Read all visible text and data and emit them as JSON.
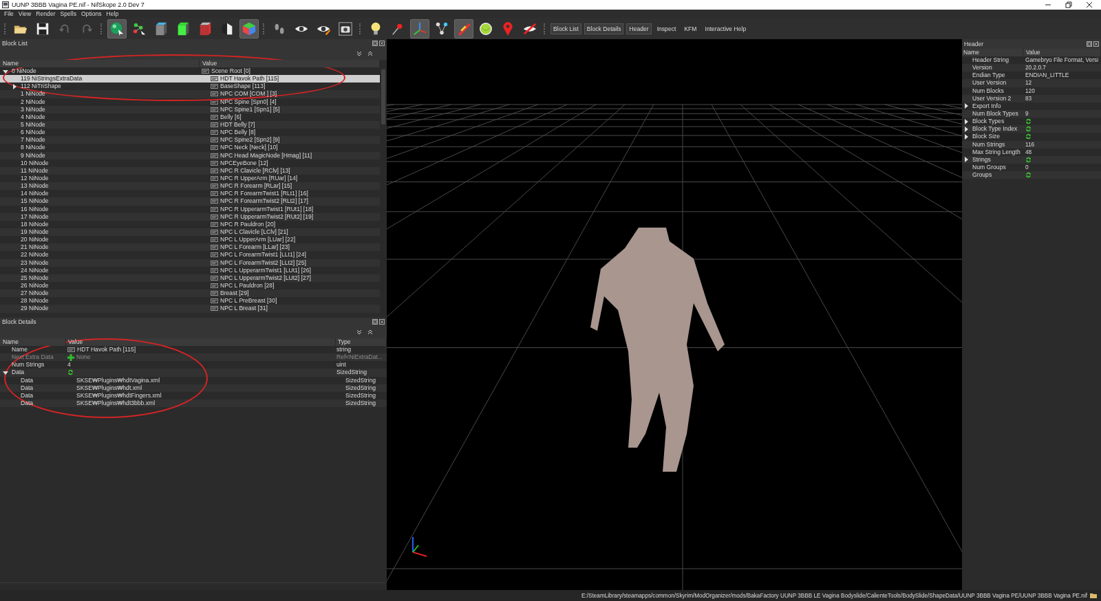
{
  "window": {
    "title": "UUNP 3BBB Vagina PE.nif - NifSkope 2.0 Dev 7"
  },
  "menu": [
    "File",
    "View",
    "Render",
    "Spells",
    "Options",
    "Help"
  ],
  "toolbar": {
    "tools": [
      {
        "pressed": false
      },
      {
        "pressed": false
      },
      {
        "pressed": false
      },
      {
        "pressed": false
      },
      {
        "pressed": true
      },
      {
        "pressed": false
      },
      {
        "pressed": false
      },
      {
        "pressed": false
      },
      {
        "pressed": false
      },
      {
        "pressed": false
      },
      {
        "pressed": true
      },
      {
        "pressed": false
      },
      {
        "pressed": false
      },
      {
        "pressed": false
      },
      {
        "pressed": false
      },
      {
        "pressed": false
      },
      {
        "pressed": false
      },
      {
        "pressed": true
      },
      {
        "pressed": false
      },
      {
        "pressed": true
      },
      {
        "pressed": false
      },
      {
        "pressed": false
      },
      {
        "pressed": false
      }
    ],
    "toggles": [
      {
        "label": "Block List",
        "checked": true
      },
      {
        "label": "Block Details",
        "checked": true
      },
      {
        "label": "Header",
        "checked": true
      },
      {
        "label": "Inspect",
        "checked": false
      },
      {
        "label": "KFM",
        "checked": false
      },
      {
        "label": "Interactive Help",
        "checked": false
      }
    ]
  },
  "block_list": {
    "title": "Block List",
    "columns": [
      "Name",
      "Value"
    ],
    "tree": [
      {
        "name": "0 NiNode",
        "value": "Scene Root [0]",
        "expanded": true,
        "selected": false,
        "children": [
          {
            "name": "119 NiStringsExtraData",
            "value": "HDT Havok Path [115]",
            "selected": true,
            "kind": "txt"
          },
          {
            "name": "112 NiTriShape",
            "value": "BaseShape [113]",
            "expanded": false,
            "selected": false
          },
          {
            "name": "1 NiNode",
            "value": "NPC COM [COM ] [3]",
            "selected": false
          },
          {
            "name": "2 NiNode",
            "value": "NPC Spine [Spn0] [4]",
            "selected": false
          },
          {
            "name": "3 NiNode",
            "value": "NPC Spine1 [Spn1] [5]",
            "selected": false
          },
          {
            "name": "4 NiNode",
            "value": "Belly [6]",
            "selected": false
          },
          {
            "name": "5 NiNode",
            "value": "HDT Belly [7]",
            "selected": false
          },
          {
            "name": "6 NiNode",
            "value": "NPC Belly [8]",
            "selected": false
          },
          {
            "name": "7 NiNode",
            "value": "NPC Spine2 [Spn2] [9]",
            "selected": false
          },
          {
            "name": "8 NiNode",
            "value": "NPC Neck [Neck] [10]",
            "selected": false
          },
          {
            "name": "9 NiNode",
            "value": "NPC Head MagicNode [Hmag] [11]",
            "selected": false
          },
          {
            "name": "10 NiNode",
            "value": "NPCEyeBone [12]",
            "selected": false
          },
          {
            "name": "11 NiNode",
            "value": "NPC R Clavicle [RClv] [13]",
            "selected": false
          },
          {
            "name": "12 NiNode",
            "value": "NPC R UpperArm [RUar] [14]",
            "selected": false
          },
          {
            "name": "13 NiNode",
            "value": "NPC R Forearm [RLar] [15]",
            "selected": false
          },
          {
            "name": "14 NiNode",
            "value": "NPC R ForearmTwist1 [RLt1] [16]",
            "selected": false
          },
          {
            "name": "15 NiNode",
            "value": "NPC R ForearmTwist2 [RLt2] [17]",
            "selected": false
          },
          {
            "name": "16 NiNode",
            "value": "NPC R UpperarmTwist1 [RUt1] [18]",
            "selected": false
          },
          {
            "name": "17 NiNode",
            "value": "NPC R UpperarmTwist2 [RUt2] [19]",
            "selected": false
          },
          {
            "name": "18 NiNode",
            "value": "NPC R Pauldron [20]",
            "selected": false
          },
          {
            "name": "19 NiNode",
            "value": "NPC L Clavicle [LClv] [21]",
            "selected": false
          },
          {
            "name": "20 NiNode",
            "value": "NPC L UpperArm [LUar] [22]",
            "selected": false
          },
          {
            "name": "21 NiNode",
            "value": "NPC L Forearm [LLar] [23]",
            "selected": false
          },
          {
            "name": "22 NiNode",
            "value": "NPC L ForearmTwist1 [LLt1] [24]",
            "selected": false
          },
          {
            "name": "23 NiNode",
            "value": "NPC L ForearmTwist2 [LLt2] [25]",
            "selected": false
          },
          {
            "name": "24 NiNode",
            "value": "NPC L UpperarmTwist1 [LUt1] [26]",
            "selected": false
          },
          {
            "name": "25 NiNode",
            "value": "NPC L UpperarmTwist2 [LUt2] [27]",
            "selected": false
          },
          {
            "name": "26 NiNode",
            "value": "NPC L Pauldron [28]",
            "selected": false
          },
          {
            "name": "27 NiNode",
            "value": "Breast [29]",
            "selected": false
          },
          {
            "name": "28 NiNode",
            "value": "NPC L PreBreast [30]",
            "selected": false
          },
          {
            "name": "29 NiNode",
            "value": "NPC L Breast [31]",
            "selected": false
          }
        ]
      }
    ]
  },
  "block_details": {
    "title": "Block Details",
    "columns": [
      "Name",
      "Value",
      "Type"
    ],
    "rows": [
      {
        "name": "Name",
        "kind": "string",
        "value": "HDT Havok Path [115]",
        "type": "string",
        "disabled": false
      },
      {
        "name": "Next Extra Data",
        "kind": "link",
        "value": "None",
        "type": "Ref<NiExtraDat...",
        "disabled": true
      },
      {
        "name": "Num Strings",
        "kind": "plain",
        "value": "4",
        "type": "uint",
        "disabled": false
      },
      {
        "name": "Data",
        "kind": "array",
        "type": "SizedString",
        "disabled": false,
        "expanded": true,
        "children": [
          {
            "name": "Data",
            "kind": "plain",
            "value": "SKSE₩Plugins₩hdtVagina.xml",
            "type": "SizedString",
            "disabled": false
          },
          {
            "name": "Data",
            "kind": "plain",
            "value": "SKSE₩Plugins₩hdt.xml",
            "type": "SizedString",
            "disabled": false
          },
          {
            "name": "Data",
            "kind": "plain",
            "value": "SKSE₩Plugins₩hdtFingers.xml",
            "type": "SizedString",
            "disabled": false
          },
          {
            "name": "Data",
            "kind": "plain",
            "value": "SKSE₩Plugins₩hdt3bbb.xml",
            "type": "SizedString",
            "disabled": false
          }
        ]
      }
    ]
  },
  "header": {
    "title": "Header",
    "columns": [
      "Name",
      "Value"
    ],
    "rows": [
      {
        "name": "Header String",
        "kind": "plain",
        "value": "Gamebryo File Format, Versi"
      },
      {
        "name": "Version",
        "kind": "plain",
        "value": "20.2.0.7"
      },
      {
        "name": "Endian Type",
        "kind": "plain",
        "value": "ENDIAN_LITTLE"
      },
      {
        "name": "User Version",
        "kind": "plain",
        "value": "12"
      },
      {
        "name": "Num Blocks",
        "kind": "plain",
        "value": "120"
      },
      {
        "name": "User Version 2",
        "kind": "plain",
        "value": "83"
      },
      {
        "name": "Export Info",
        "kind": "group",
        "expanded": false
      },
      {
        "name": "Num Block Types",
        "kind": "plain",
        "value": "9"
      },
      {
        "name": "Block Types",
        "kind": "array",
        "expanded": false
      },
      {
        "name": "Block Type Index",
        "kind": "array",
        "expanded": false
      },
      {
        "name": "Block Size",
        "kind": "array",
        "expanded": false
      },
      {
        "name": "Num Strings",
        "kind": "plain",
        "value": "116"
      },
      {
        "name": "Max String Length",
        "kind": "plain",
        "value": "48"
      },
      {
        "name": "Strings",
        "kind": "array",
        "expanded": false
      },
      {
        "name": "Num Groups",
        "kind": "plain",
        "value": "0"
      },
      {
        "name": "Groups",
        "kind": "array"
      }
    ]
  },
  "markup": {
    "block_list_circled": true,
    "block_details_circled": true
  },
  "status_bar": {
    "path": "E:/SteamLibrary/steamapps/common/Skyrim/ModOrganizer/mods/BakaFactory UUNP 3BBB LE Vagina Bodyslide/CalienteTools/BodySlide/ShapeData/UUNP 3BBB Vagina PE/UUNP 3BBB Vagina PE.nif"
  }
}
